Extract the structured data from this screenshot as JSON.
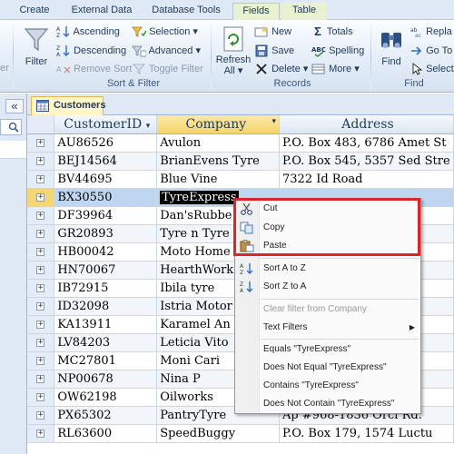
{
  "ribbon_tabs": [
    {
      "label": "Create",
      "active": false
    },
    {
      "label": "External Data",
      "active": false
    },
    {
      "label": "Database Tools",
      "active": false
    },
    {
      "label": "Fields",
      "active": true
    },
    {
      "label": "Table",
      "active": false
    }
  ],
  "ribbon": {
    "filter_label": "Filter",
    "ascending_label": "Ascending",
    "descending_label": "Descending",
    "remove_sort_label": "Remove Sort",
    "selection_label": "Selection",
    "advanced_label": "Advanced",
    "toggle_filter_label": "Toggle Filter",
    "sort_filter_group": "Sort & Filter",
    "refresh_label": "Refresh",
    "refresh_all_label": "All",
    "new_label": "New",
    "save_label": "Save",
    "delete_label": "Delete",
    "totals_label": "Totals",
    "spelling_label": "Spelling",
    "more_label": "More",
    "records_group": "Records",
    "find_label": "Find",
    "replace_label": "Repla",
    "goto_label": "Go To",
    "select_label": "Select",
    "find_group": "Find"
  },
  "nav": {
    "collapse_symbol": "«"
  },
  "document": {
    "tab_label": "Customers"
  },
  "table": {
    "columns": [
      "CustomerID",
      "Company",
      "Address"
    ],
    "rows": [
      {
        "id": "AU86526",
        "company": "Avulon",
        "address": "P.O. Box 483, 6786 Amet St"
      },
      {
        "id": "BEJ14564",
        "company": "BrianEvens Tyre",
        "address": "P.O. Box 545, 5357 Sed Stre"
      },
      {
        "id": "BV44695",
        "company": "Blue Vine",
        "address": "7322 Id Road"
      },
      {
        "id": "BX30550",
        "company": "TyreExpress",
        "address": ""
      },
      {
        "id": "DF39964",
        "company": "Dan'sRubbe",
        "address": ""
      },
      {
        "id": "GR20893",
        "company": "Tyre n Tyre",
        "address": ""
      },
      {
        "id": "HB00042",
        "company": "Moto Home",
        "address": ""
      },
      {
        "id": "HN70067",
        "company": "HearthWork",
        "address": "Ave"
      },
      {
        "id": "IB72915",
        "company": "Ibila tyre",
        "address": ""
      },
      {
        "id": "ID32098",
        "company": "Istria Motor",
        "address": "ctus"
      },
      {
        "id": "KA13911",
        "company": "Karamel An",
        "address": ""
      },
      {
        "id": "LV84203",
        "company": "Leticia Vito",
        "address": ""
      },
      {
        "id": "MC27801",
        "company": "Moni Cari",
        "address": "lit. Ave"
      },
      {
        "id": "NP00678",
        "company": "Nina P",
        "address": ""
      },
      {
        "id": "OW62198",
        "company": "Oilworks",
        "address": "St."
      },
      {
        "id": "PX65302",
        "company": "PantryTyre",
        "address": "Ap #968-1836 Orci Rd."
      },
      {
        "id": "RL63600",
        "company": "SpeedBuggy",
        "address": "P.O. Box 179, 1574 Luctu"
      }
    ]
  },
  "context_menu": {
    "items": [
      {
        "label": "Cut",
        "icon": "scissors-icon",
        "disabled": false
      },
      {
        "label": "Copy",
        "icon": "copy-icon",
        "disabled": false
      },
      {
        "label": "Paste",
        "icon": "paste-icon",
        "disabled": false
      },
      {
        "label": "Sort A to Z",
        "icon": "sort-ascending-icon",
        "disabled": false
      },
      {
        "label": "Sort Z to A",
        "icon": "sort-descending-icon",
        "disabled": false
      },
      {
        "label": "Clear filter from Company",
        "icon": "",
        "disabled": true
      },
      {
        "label": "Text Filters",
        "icon": "",
        "disabled": false,
        "submenu": true
      },
      {
        "label": "Equals \"TyreExpress\"",
        "icon": "",
        "disabled": false
      },
      {
        "label": "Does Not Equal \"TyreExpress\"",
        "icon": "",
        "disabled": false
      },
      {
        "label": "Contains \"TyreExpress\"",
        "icon": "",
        "disabled": false
      },
      {
        "label": "Does Not Contain \"TyreExpress\"",
        "icon": "",
        "disabled": false
      }
    ]
  },
  "colors": {
    "highlight_box": "#d9262a",
    "selected_row": "#bfd6f1",
    "active_tab": "#fff5c8"
  }
}
